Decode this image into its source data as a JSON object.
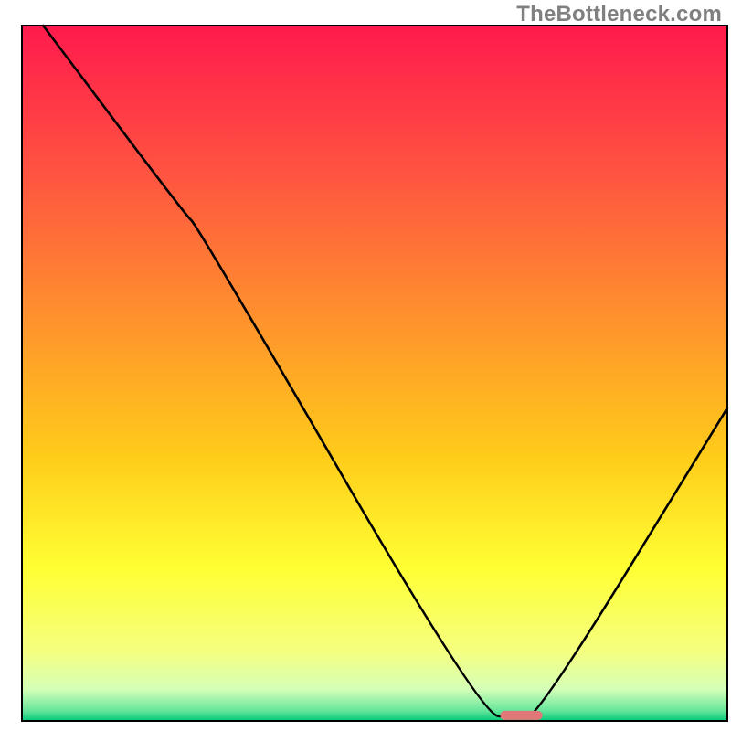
{
  "watermark": "TheBottleneck.com",
  "chart_data": {
    "type": "line",
    "title": "",
    "xlabel": "",
    "ylabel": "",
    "xlim": [
      0,
      100
    ],
    "ylim": [
      0,
      100
    ],
    "series": [
      {
        "name": "curve",
        "x": [
          3,
          23,
          25,
          65,
          70,
          73,
          100
        ],
        "y": [
          100,
          73,
          71,
          1,
          0.4,
          0.4,
          45
        ]
      }
    ],
    "marker": {
      "x": 70.8,
      "y": 0.8,
      "length": 6
    },
    "background_gradient": {
      "stops": [
        {
          "pos": 0.0,
          "color": "#ff1a4d"
        },
        {
          "pos": 0.22,
          "color": "#ff5640"
        },
        {
          "pos": 0.45,
          "color": "#ff9a2a"
        },
        {
          "pos": 0.62,
          "color": "#ffcc1a"
        },
        {
          "pos": 0.78,
          "color": "#ffff33"
        },
        {
          "pos": 0.9,
          "color": "#f5ff80"
        },
        {
          "pos": 0.955,
          "color": "#d4ffb8"
        },
        {
          "pos": 0.985,
          "color": "#66e69c"
        },
        {
          "pos": 1.0,
          "color": "#00c878"
        }
      ]
    },
    "axes": {
      "frame_color": "#000000",
      "frame_width": 2
    }
  }
}
